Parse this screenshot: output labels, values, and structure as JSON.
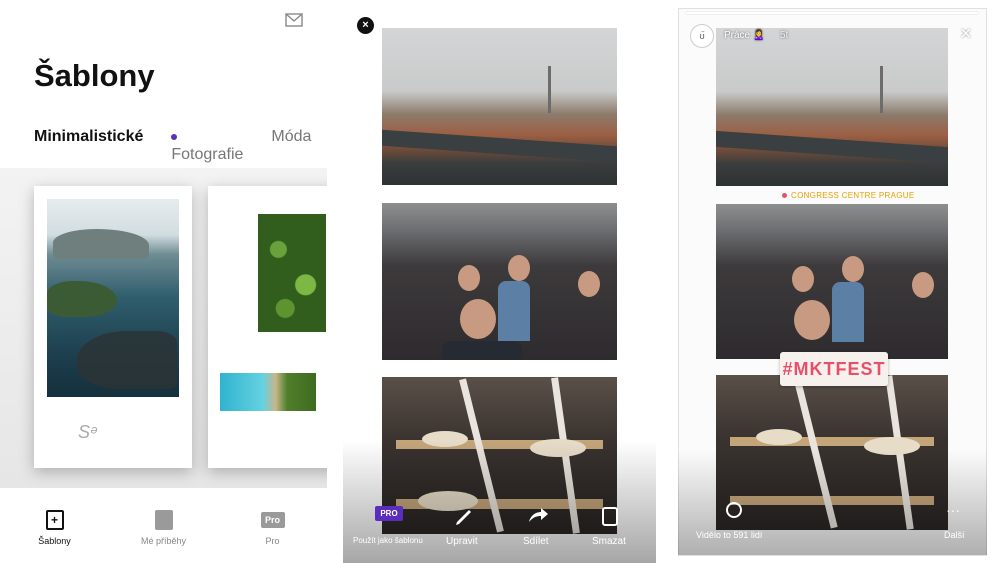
{
  "screen1": {
    "title": "Šablony",
    "tabs": [
      {
        "label": "Minimalistické",
        "active": true
      },
      {
        "label": "Fotografie",
        "dot_color": "#5b2ec0"
      },
      {
        "label": "Móda"
      }
    ],
    "bottom_nav": [
      {
        "label": "Šablony",
        "icon": "template-add-icon",
        "active": true
      },
      {
        "label": "Mé příběhy",
        "icon": "stories-icon"
      },
      {
        "label": "Pro",
        "icon": "pro-icon",
        "icon_text": "Pro"
      }
    ],
    "signature": "Sᵊ"
  },
  "screen2": {
    "close_icon": "×",
    "pro_badge": "PRO",
    "actions": [
      {
        "label": "Použít jako šablonu",
        "icon": "use-template-icon"
      },
      {
        "label": "Upravit",
        "icon": "edit-pen-icon"
      },
      {
        "label": "Sdílet",
        "icon": "share-icon"
      },
      {
        "label": "Smazat",
        "icon": "delete-icon"
      }
    ]
  },
  "screen3": {
    "avatar_text": "ʊ̈",
    "user": "Práce 🙎‍♀️",
    "time": "5t",
    "close": "×",
    "location": "CONGRESS CENTRE PRAGUE",
    "hashtag": "#MKTFEST",
    "seen_by": "Vidělo to 591 lidí",
    "next": "Další",
    "more": "···"
  },
  "colors": {
    "accent_purple": "#5b2ec0",
    "location_orange": "#e8a200",
    "hashtag_pink": "#e8506a"
  }
}
